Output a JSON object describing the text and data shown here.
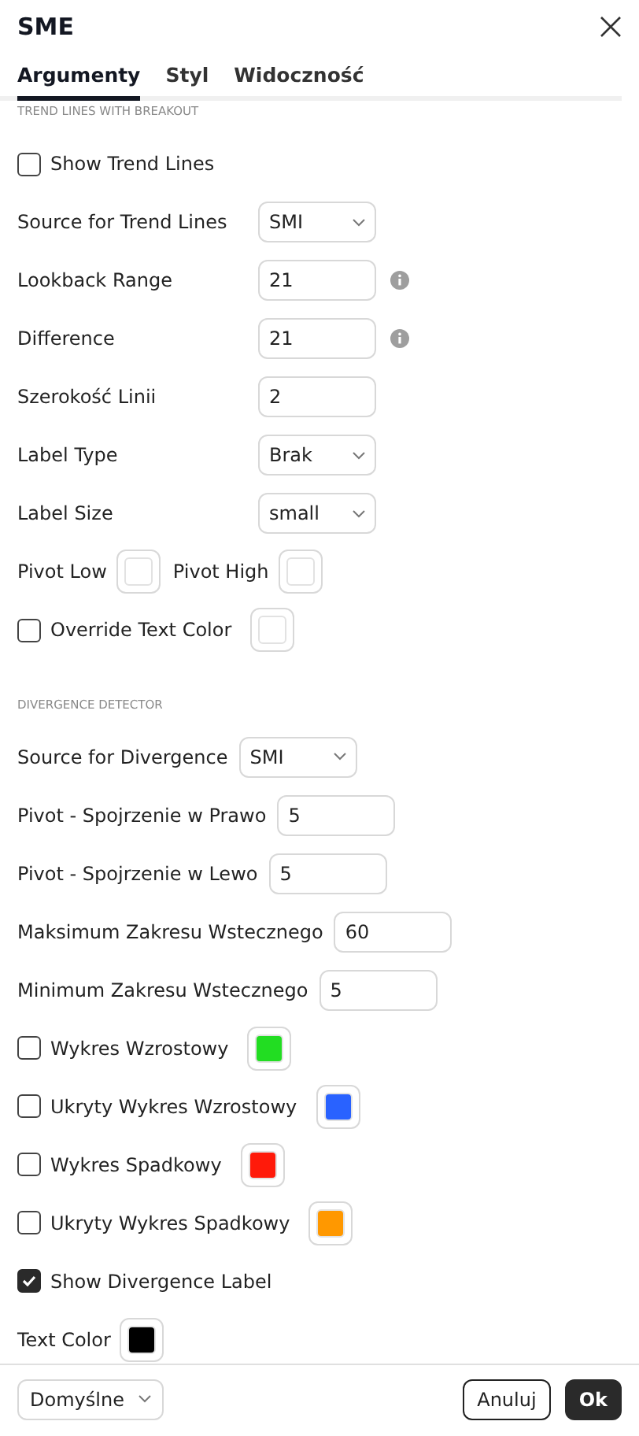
{
  "dialog": {
    "title": "SME"
  },
  "tabs": [
    {
      "label": "Argumenty",
      "selected": true
    },
    {
      "label": "Styl",
      "selected": false
    },
    {
      "label": "Widoczność",
      "selected": false
    }
  ],
  "sections": [
    {
      "title": "TREND LINES WITH BREAKOUT",
      "kind": "aligned",
      "rows": [
        {
          "kind": "checkbox",
          "label": "Show Trend Lines",
          "checked": false
        },
        {
          "kind": "select",
          "label": "Source for Trend Lines",
          "value": "SMI"
        },
        {
          "kind": "input",
          "label": "Lookback Range",
          "value": "21",
          "info": true
        },
        {
          "kind": "input",
          "label": "Difference",
          "value": "21",
          "info": true
        },
        {
          "kind": "input",
          "label": "Szerokość Linii",
          "value": "2",
          "info": false
        },
        {
          "kind": "select",
          "label": "Label Type",
          "value": "Brak"
        },
        {
          "kind": "select",
          "label": "Label Size",
          "value": "small"
        },
        {
          "kind": "color_pair",
          "items": [
            {
              "label": "Pivot Low",
              "color": "#ffffff"
            },
            {
              "label": "Pivot High",
              "color": "#ffffff"
            }
          ]
        },
        {
          "kind": "checkbox",
          "label": "Override Text Color",
          "checked": false,
          "color": "#ffffff"
        }
      ]
    },
    {
      "title": "DIVERGENCE DETECTOR",
      "kind": "inline",
      "rows": [
        {
          "kind": "select",
          "label": "Source for Divergence",
          "value": "SMI"
        },
        {
          "kind": "input",
          "label": "Pivot - Spojrzenie w Prawo",
          "value": "5",
          "info": false
        },
        {
          "kind": "input",
          "label": "Pivot - Spojrzenie w Lewo",
          "value": "5",
          "info": false
        },
        {
          "kind": "input",
          "label": "Maksimum Zakresu Wstecznego",
          "value": "60",
          "info": false
        },
        {
          "kind": "input",
          "label": "Minimum Zakresu Wstecznego",
          "value": "5",
          "info": false
        },
        {
          "kind": "checkbox",
          "label": "Wykres Wzrostowy",
          "checked": false,
          "color": "#22dd22"
        },
        {
          "kind": "checkbox",
          "label": "Ukryty Wykres Wzrostowy",
          "checked": false,
          "color": "#2962ff"
        },
        {
          "kind": "checkbox",
          "label": "Wykres Spadkowy",
          "checked": false,
          "color": "#ff1a0a"
        },
        {
          "kind": "checkbox",
          "label": "Ukryty Wykres Spadkowy",
          "checked": false,
          "color": "#ff9800"
        },
        {
          "kind": "checkbox",
          "label": "Show Divergence Label",
          "checked": true
        },
        {
          "kind": "color_pair",
          "items": [
            {
              "label": "Text Color",
              "color": "#000000"
            }
          ]
        }
      ]
    }
  ],
  "footer": {
    "preset": "Domyślne",
    "cancel": "Anuluj",
    "ok": "Ok"
  }
}
